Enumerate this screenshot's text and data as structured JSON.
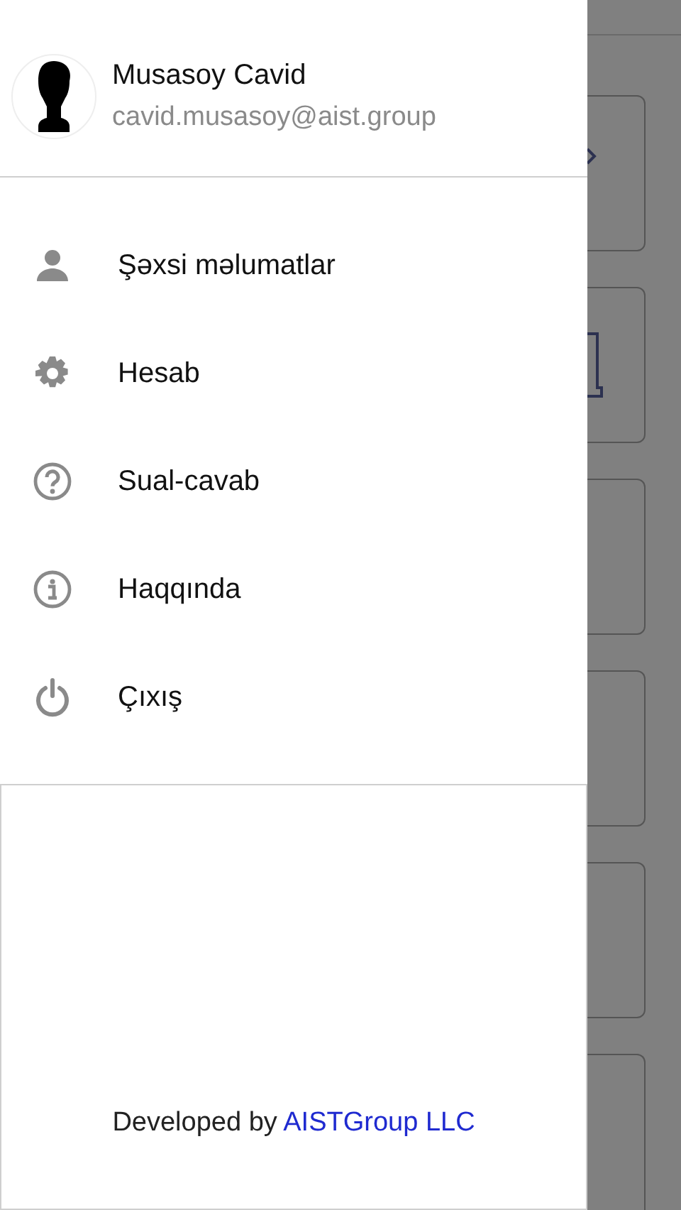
{
  "drawer": {
    "profile": {
      "name": "Musasoy Cavid",
      "email": "cavid.musasoy@aist.group"
    },
    "menu": [
      {
        "label": "Şəxsi məlumatlar"
      },
      {
        "label": "Hesab"
      },
      {
        "label": "Sual-cavab"
      },
      {
        "label": "Haqqında"
      },
      {
        "label": "Çıxış"
      }
    ],
    "footer": {
      "text": "Developed by",
      "link": "AISTGroup LLC"
    }
  }
}
